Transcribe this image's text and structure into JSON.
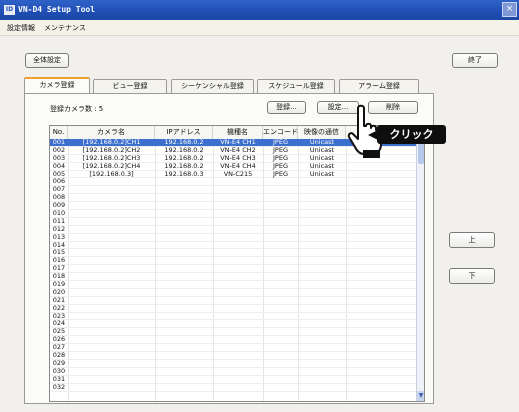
{
  "window": {
    "icon_text": "ID",
    "title": "VN-D4 Setup Tool",
    "close_glyph": "×"
  },
  "menu": {
    "items": [
      "設定情報",
      "メンテナンス"
    ]
  },
  "toolbar": {
    "all_settings_label": "全体設定",
    "exit_label": "終了"
  },
  "tabs": [
    {
      "label": "カメラ登録",
      "active": true
    },
    {
      "label": "ビュー登録",
      "active": false
    },
    {
      "label": "シーケンシャル登録",
      "active": false
    },
    {
      "label": "スケジュール登録",
      "active": false
    },
    {
      "label": "アラーム登録",
      "active": false
    }
  ],
  "camera_panel": {
    "count_label": "登録カメラ数 : 5",
    "register_label": "登録...",
    "settings_label": "設定...",
    "delete_label": "削除"
  },
  "table": {
    "columns": [
      "No.",
      "カメラ名",
      "IPアドレス",
      "機種名",
      "エンコード",
      "映像の通信"
    ],
    "rows": [
      {
        "no": "001",
        "name": "[192.168.0.2]CH1",
        "ip": "192.168.0.2",
        "model": "VN-E4 CH1",
        "enc": "JPEG",
        "comm": "Unicast"
      },
      {
        "no": "002",
        "name": "[192.168.0.2]CH2",
        "ip": "192.168.0.2",
        "model": "VN-E4 CH2",
        "enc": "JPEG",
        "comm": "Unicast"
      },
      {
        "no": "003",
        "name": "[192.168.0.2]CH3",
        "ip": "192.168.0.2",
        "model": "VN-E4 CH3",
        "enc": "JPEG",
        "comm": "Unicast"
      },
      {
        "no": "004",
        "name": "[192.168.0.2]CH4",
        "ip": "192.168.0.2",
        "model": "VN-E4 CH4",
        "enc": "JPEG",
        "comm": "Unicast"
      },
      {
        "no": "005",
        "name": "[192.168.0.3]",
        "ip": "192.168.0.3",
        "model": "VN-C215",
        "enc": "JPEG",
        "comm": "Unicast"
      }
    ],
    "empty_rows": [
      "006",
      "007",
      "008",
      "009",
      "010",
      "011",
      "012",
      "013",
      "014",
      "015",
      "016",
      "017",
      "018",
      "019",
      "020",
      "021",
      "022",
      "023",
      "024",
      "025",
      "026",
      "027",
      "028",
      "029",
      "030",
      "031",
      "032"
    ],
    "selected_index": 0,
    "scroll_down_glyph": "▼"
  },
  "side_buttons": {
    "up_label": "上",
    "down_label": "下"
  },
  "annotation": {
    "click_label": "クリック"
  },
  "colors": {
    "selection": "#3d6fcf",
    "titlebar": "#2554b8",
    "tab_accent": "#f0a030"
  }
}
